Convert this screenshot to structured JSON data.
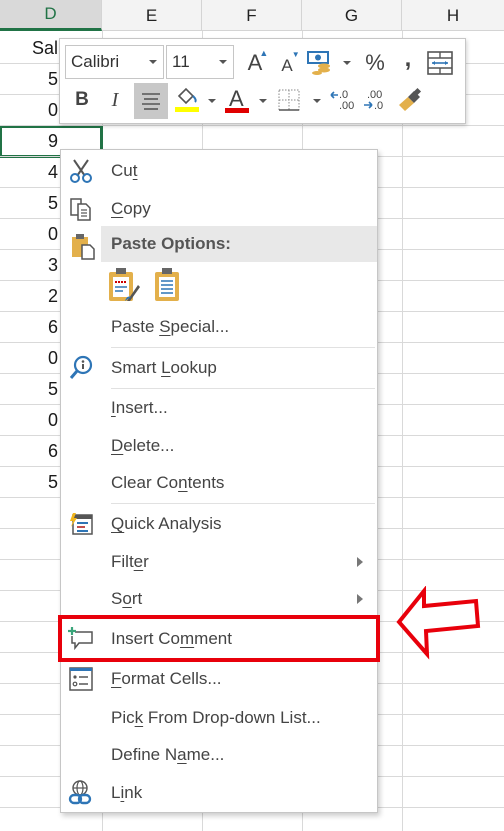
{
  "columns": [
    {
      "label": "D",
      "selected": true
    },
    {
      "label": "E",
      "selected": false
    },
    {
      "label": "F",
      "selected": false
    },
    {
      "label": "G",
      "selected": false
    },
    {
      "label": "H",
      "selected": false
    }
  ],
  "column_d_cells": [
    "Sal",
    "5",
    "0",
    "9",
    "4",
    "5",
    "0",
    "3",
    "2",
    "6",
    "0",
    "5",
    "0",
    "6",
    "5"
  ],
  "selected_cell_index": 3,
  "mini_toolbar": {
    "font_name": "Calibri",
    "font_size": "11",
    "bold_label": "B",
    "italic_label": "I",
    "percent_label": "%",
    "comma_label": ",",
    "increase_font_label": "A",
    "decrease_font_label": "A",
    "font_color_label": "A",
    "increase_decimal_label": "←.0 .00",
    "decrease_decimal_label": ".00 →.0",
    "fill_color": "#ffff00",
    "font_color": "#e00000"
  },
  "context_menu": {
    "items": [
      {
        "label": "Cut",
        "icon": "scissors-icon"
      },
      {
        "label": "Copy",
        "icon": "copy-icon"
      },
      {
        "label": "Paste Options:",
        "icon": "paste-icon"
      },
      {
        "label": "Paste Special...",
        "icon": null
      },
      {
        "label": "Smart Lookup",
        "icon": "smart-lookup-icon"
      },
      {
        "label": "Insert...",
        "icon": null
      },
      {
        "label": "Delete...",
        "icon": null
      },
      {
        "label": "Clear Contents",
        "icon": null
      },
      {
        "label": "Quick Analysis",
        "icon": "quick-analysis-icon"
      },
      {
        "label": "Filter",
        "icon": null,
        "submenu": true
      },
      {
        "label": "Sort",
        "icon": null,
        "submenu": true
      },
      {
        "label": "Insert Comment",
        "icon": "insert-comment-icon",
        "highlighted": true
      },
      {
        "label": "Format Cells...",
        "icon": "format-cells-icon"
      },
      {
        "label": "Pick From Drop-down List...",
        "icon": null
      },
      {
        "label": "Define Name...",
        "icon": null
      },
      {
        "label": "Link",
        "icon": "link-icon"
      }
    ]
  },
  "annotation": {
    "color": "#e8000b",
    "target": "Insert Comment"
  }
}
